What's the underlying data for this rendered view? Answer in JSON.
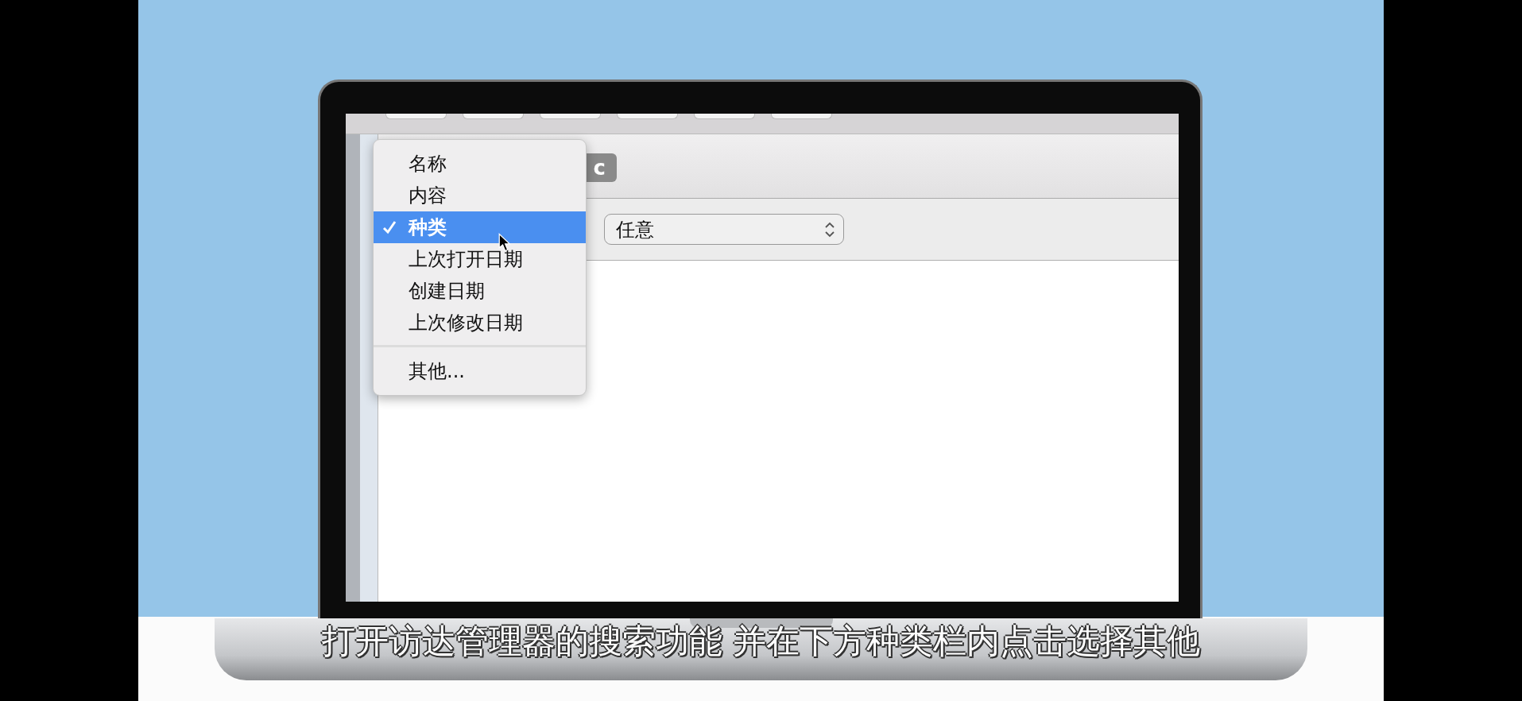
{
  "search_bar": {
    "scope_badge": "c"
  },
  "criteria_row": {
    "value_popup": "任意"
  },
  "attribute_menu": {
    "items": [
      {
        "label": "名称",
        "selected": false
      },
      {
        "label": "内容",
        "selected": false
      },
      {
        "label": "种类",
        "selected": true
      },
      {
        "label": "上次打开日期",
        "selected": false
      },
      {
        "label": "创建日期",
        "selected": false
      },
      {
        "label": "上次修改日期",
        "selected": false
      }
    ],
    "other": "其他..."
  },
  "subtitle": "打开访达管理器的搜索功能 并在下方种类栏内点击选择其他"
}
